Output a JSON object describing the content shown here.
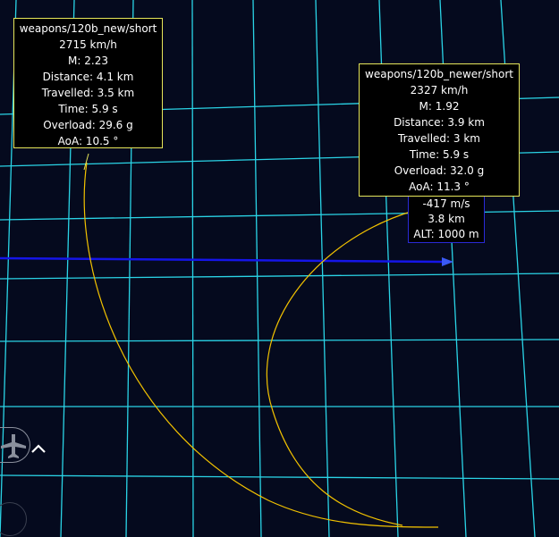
{
  "colors": {
    "background": "#050a1e",
    "grid": "#2ad4e6",
    "trajectory": "#f2c200",
    "target_track": "#1515e8",
    "missile_label_border": "#e6e65a",
    "target_label_border": "#2a2ad8"
  },
  "missile_a": {
    "name": "weapons/120b_new/short",
    "speed": "2715 km/h",
    "mach": "M: 2.23",
    "distance": "Distance: 4.1 km",
    "travelled": "Travelled: 3.5 km",
    "time": "Time: 5.9 s",
    "overload": "Overload: 29.6 g",
    "aoa": "AoA: 10.5 °"
  },
  "missile_b": {
    "name": "weapons/120b_newer/short",
    "speed": "2327 km/h",
    "mach": "M: 1.92",
    "distance": "Distance: 3.9 km",
    "travelled": "Travelled: 3 km",
    "time": "Time: 5.9 s",
    "overload": "Overload: 32.0 g",
    "aoa": "AoA: 11.3 °"
  },
  "target": {
    "vertical_speed": "-417 m/s",
    "range": "3.8 km",
    "altitude": "ALT: 1000 m"
  },
  "hud": {
    "plane_icon": "plane-icon",
    "chevron_icon": "chevron-up-icon",
    "circle_icon": "circle-icon"
  }
}
